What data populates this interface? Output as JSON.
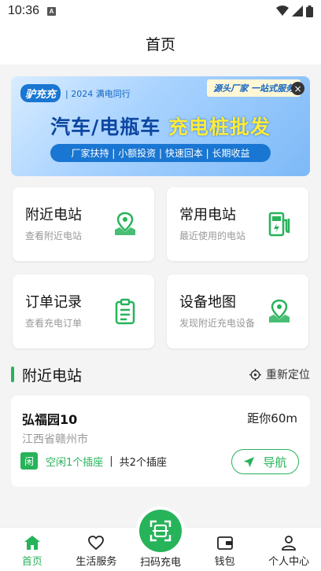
{
  "status_bar": {
    "time": "10:36",
    "sim_label": "A"
  },
  "header": {
    "title": "首页"
  },
  "banner": {
    "brand_logo": "驴充充",
    "brand_latin": "LV CHONG",
    "brand_tagline": "| 2024 满电同行",
    "tag": "源头厂家 一站式服务",
    "close_label": "×",
    "headline_part1": "汽车/电瓶车",
    "headline_part2": "充电桩批发",
    "subline": "厂家扶持 | 小额投资 | 快速回本 | 长期收益"
  },
  "cards": [
    {
      "title": "附近电站",
      "subtitle": "查看附近电站",
      "icon": "map-pin-icon"
    },
    {
      "title": "常用电站",
      "subtitle": "最近使用的电站",
      "icon": "charging-pile-icon"
    },
    {
      "title": "订单记录",
      "subtitle": "查看充电订单",
      "icon": "clipboard-list-icon"
    },
    {
      "title": "设备地图",
      "subtitle": "发现附近充电设备",
      "icon": "map-pin-icon"
    }
  ],
  "nearby": {
    "title": "附近电站",
    "relocate_label": "重新定位",
    "station": {
      "name": "弘福园10",
      "distance": "距你60m",
      "address": "江西省赣州市",
      "badge": "闲",
      "free": "空闲1个插座",
      "separator": "|",
      "total": "共2个插座",
      "nav_label": "导航"
    }
  },
  "tabbar": {
    "items": [
      {
        "label": "首页",
        "icon": "home-icon",
        "active": true
      },
      {
        "label": "生活服务",
        "icon": "heart-icon",
        "active": false
      },
      {
        "label": "扫码充电",
        "icon": "scan-icon",
        "active": false
      },
      {
        "label": "钱包",
        "icon": "wallet-icon",
        "active": false
      },
      {
        "label": "个人中心",
        "icon": "user-icon",
        "active": false
      }
    ]
  },
  "colors": {
    "accent": "#27b35a",
    "banner_blue": "#1976d2"
  }
}
